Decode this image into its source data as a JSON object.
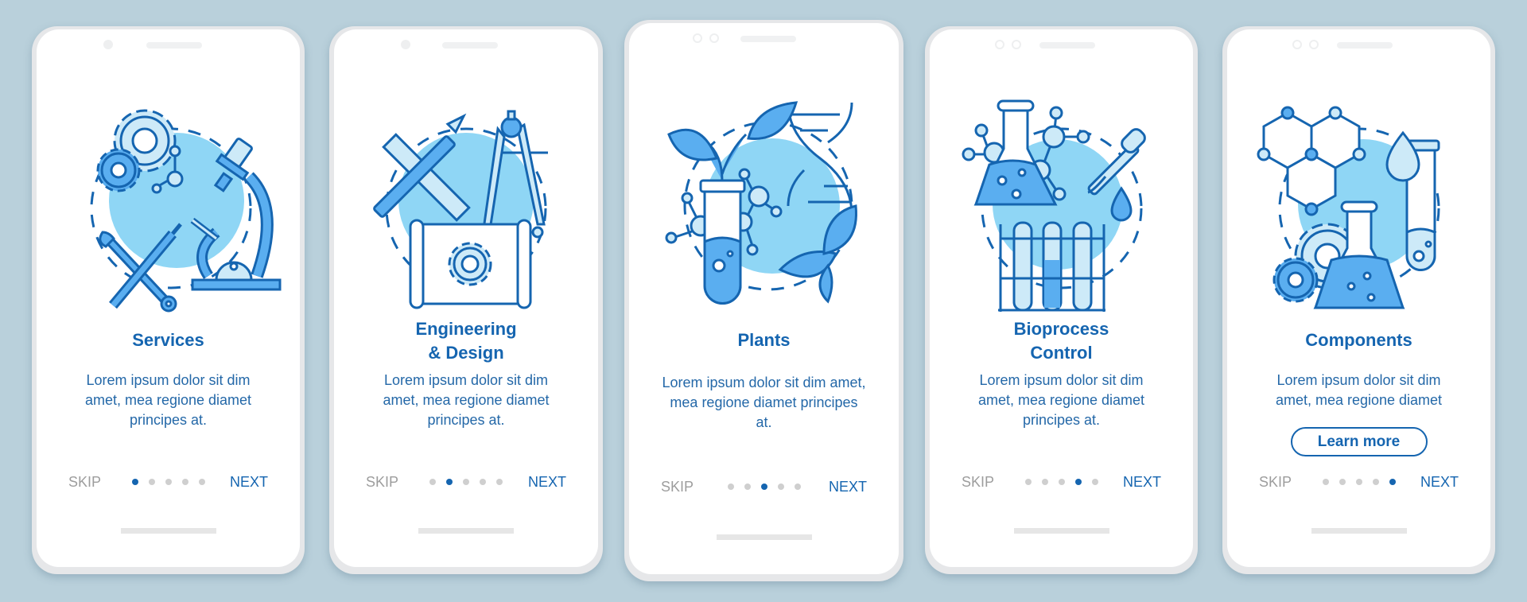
{
  "colors": {
    "background": "#b9d0db",
    "accent": "#1565b0",
    "illustration_fill": "#8fd6f5",
    "illustration_mid": "#5aaef0",
    "illustration_light": "#cdeaf8",
    "dot_inactive": "#cfcfcf",
    "skip_text": "#9d9d9d"
  },
  "screens": [
    {
      "title": "Services",
      "description": "Lorem ipsum dolor sit dim amet, mea regione diamet principes at.",
      "illustration": "services-icon",
      "skip_label": "SKIP",
      "next_label": "NEXT",
      "active_page": 1,
      "total_pages": 5
    },
    {
      "title": "Engineering & Design",
      "description": "Lorem ipsum dolor sit dim amet, mea regione diamet principes at.",
      "illustration": "engineering-design-icon",
      "skip_label": "SKIP",
      "next_label": "NEXT",
      "active_page": 2,
      "total_pages": 5
    },
    {
      "title": "Plants",
      "description": "Lorem ipsum dolor sit dim amet, mea regione diamet principes at.",
      "illustration": "plants-icon",
      "skip_label": "SKIP",
      "next_label": "NEXT",
      "active_page": 3,
      "total_pages": 5
    },
    {
      "title": "Bioprocess Control",
      "description": "Lorem ipsum dolor sit dim amet, mea regione diamet principes at.",
      "illustration": "bioprocess-control-icon",
      "skip_label": "SKIP",
      "next_label": "NEXT",
      "active_page": 4,
      "total_pages": 5
    },
    {
      "title": "Components",
      "description": "Lorem ipsum dolor sit dim amet, mea regione diamet",
      "illustration": "components-icon",
      "button_label": "Learn more",
      "skip_label": "SKIP",
      "next_label": "NEXT",
      "active_page": 5,
      "total_pages": 5
    }
  ]
}
